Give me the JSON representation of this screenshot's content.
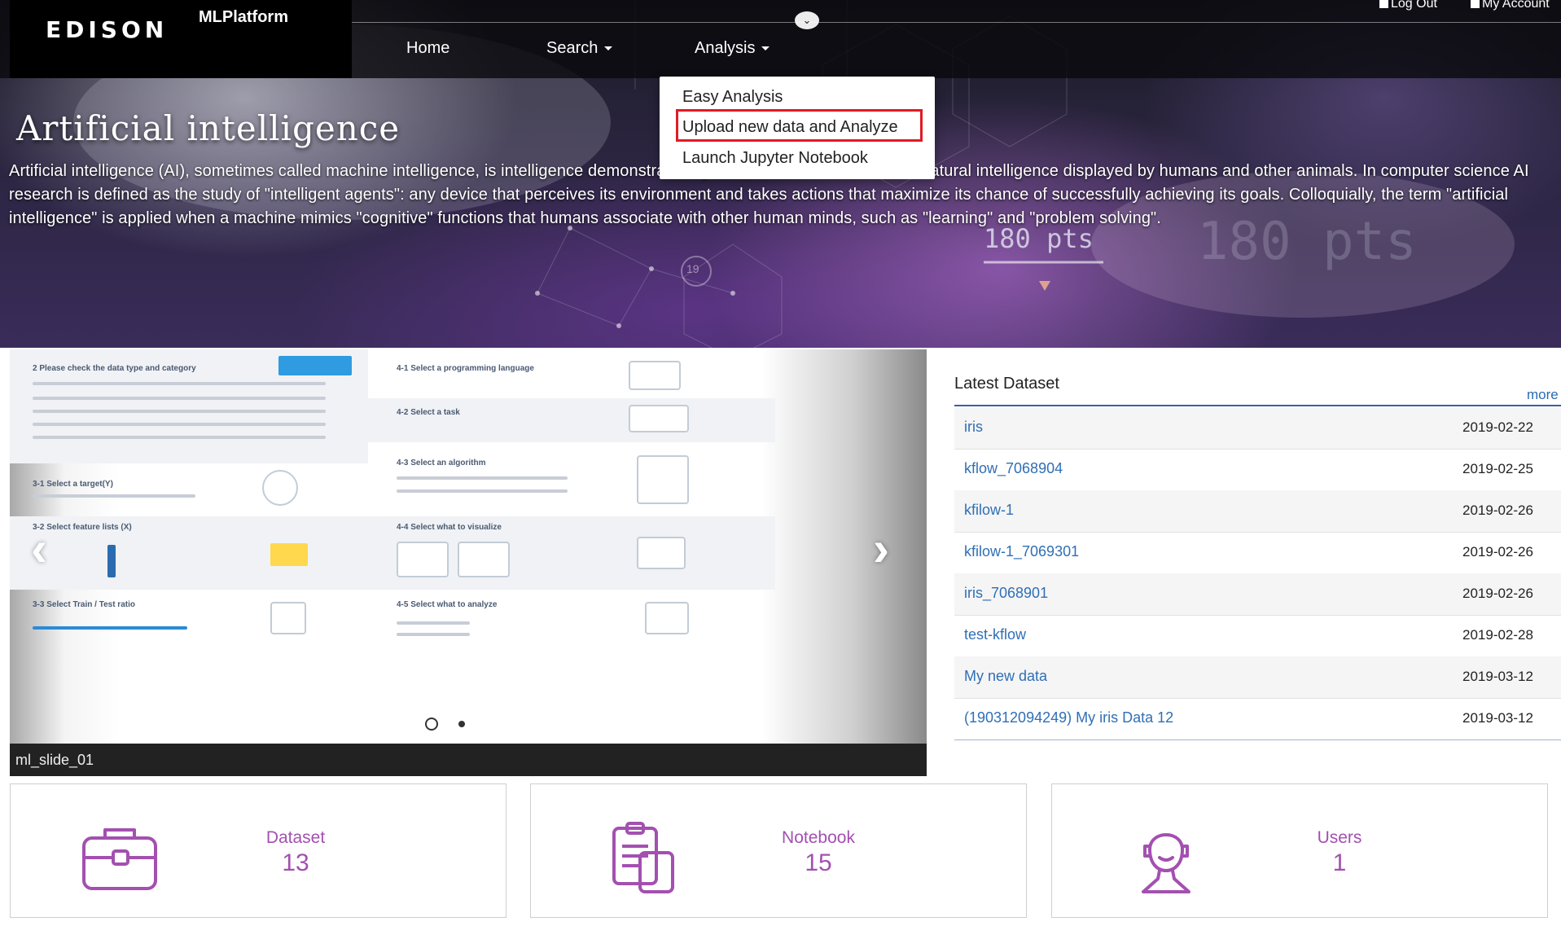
{
  "header": {
    "logo_text": "EDISON",
    "app_name": "MLPlatform",
    "top_links": {
      "logout": "Log Out",
      "account": "My Account"
    },
    "nav": [
      {
        "label": "Home"
      },
      {
        "label": "Search"
      },
      {
        "label": "Analysis"
      }
    ],
    "toggle_icon": "chevron-down-icon"
  },
  "dropdown": {
    "items": [
      {
        "label": "Easy Analysis"
      },
      {
        "label": "Upload new data and Analyze"
      },
      {
        "label": "Launch Jupyter Notebook"
      }
    ],
    "highlight_color": "#e01b24"
  },
  "hero": {
    "title": "Artificial intelligence",
    "description": "Artificial intelligence (AI), sometimes called machine intelligence, is intelligence demonstrated by machines, in contrast to the natural intelligence displayed by humans and other animals. In computer science AI research is defined as the study of \"intelligent agents\": any device that perceives its environment and takes actions that maximize its chance of successfully achieving its goals. Colloquially, the term \"artificial intelligence\" is applied when a machine mimics \"cognitive\" functions that humans associate with other human minds, such as \"learning\" and \"problem solving\".",
    "overlay_text": "180 pts",
    "overlay_text_faint": "180 pts",
    "badge_number": "19"
  },
  "carousel": {
    "caption": "ml_slide_01",
    "slide_count": 2,
    "active_slide": 1,
    "prev_icon": "chevron-left-icon",
    "next_icon": "chevron-right-icon",
    "steps": [
      {
        "label": "2 Please check the data type and category"
      },
      {
        "label": "3-1 Select a target(Y)"
      },
      {
        "label": "3-2 Select feature lists (X)"
      },
      {
        "label": "3-3 Select Train / Test ratio"
      },
      {
        "label": "4-1 Select a programming language"
      },
      {
        "label": "4-2 Select a task"
      },
      {
        "label": "4-3 Select an algorithm"
      },
      {
        "label": "4-4 Select what to visualize"
      },
      {
        "label": "4-5 Select what to analyze"
      }
    ]
  },
  "latest": {
    "title": "Latest Dataset",
    "more": "more",
    "rows": [
      {
        "name": "iris",
        "date": "2019-02-22"
      },
      {
        "name": "kflow_7068904",
        "date": "2019-02-25"
      },
      {
        "name": "kfilow-1",
        "date": "2019-02-26"
      },
      {
        "name": "kfilow-1_7069301",
        "date": "2019-02-26"
      },
      {
        "name": "iris_7068901",
        "date": "2019-02-26"
      },
      {
        "name": "test-kflow",
        "date": "2019-02-28"
      },
      {
        "name": "My new data",
        "date": "2019-03-12"
      },
      {
        "name": "(190312094249) My iris Data 12",
        "date": "2019-03-12"
      }
    ]
  },
  "stats": [
    {
      "label": "Dataset",
      "value": "13",
      "icon": "briefcase-icon"
    },
    {
      "label": "Notebook",
      "value": "15",
      "icon": "clipboard-icon"
    },
    {
      "label": "Users",
      "value": "1",
      "icon": "user-icon"
    }
  ],
  "colors": {
    "accent": "#a350b0",
    "link": "#2f6fb5",
    "rule": "#3a5ea8"
  }
}
